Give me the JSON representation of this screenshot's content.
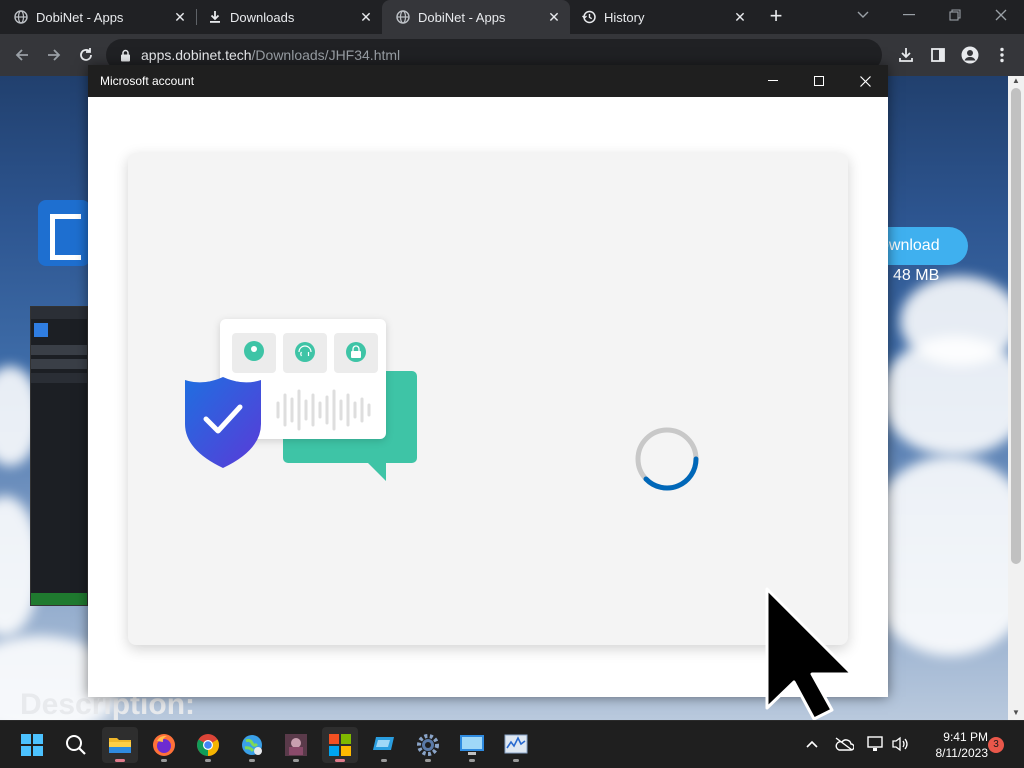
{
  "browser": {
    "tabs": [
      {
        "title": "DobiNet - Apps",
        "icon": "globe-icon",
        "active": false
      },
      {
        "title": "Downloads",
        "icon": "download-icon",
        "active": false
      },
      {
        "title": "DobiNet - Apps",
        "icon": "globe-icon",
        "active": true
      },
      {
        "title": "History",
        "icon": "history-icon",
        "active": false
      }
    ],
    "new_tab_label": "+",
    "url_host": "apps.dobinet.tech",
    "url_path": "/Downloads/JHF34.html"
  },
  "page": {
    "download_label": "ownload",
    "download_size": "48 MB",
    "description_heading": "Description:",
    "accent_color": "#3fb0ef"
  },
  "dialog": {
    "title": "Microsoft account",
    "state": "loading"
  },
  "taskbar": {
    "apps": [
      {
        "name": "start-icon"
      },
      {
        "name": "search-icon"
      },
      {
        "name": "file-explorer-icon",
        "active": true
      },
      {
        "name": "firefox-icon"
      },
      {
        "name": "chrome-icon"
      },
      {
        "name": "globe-app-icon"
      },
      {
        "name": "media-app-icon"
      },
      {
        "name": "microsoft-store-icon",
        "active": true
      },
      {
        "name": "disk-app-icon"
      },
      {
        "name": "settings-icon"
      },
      {
        "name": "remote-desktop-icon"
      },
      {
        "name": "resource-monitor-icon"
      }
    ],
    "time": "9:41 PM",
    "date": "8/11/2023",
    "notification_count": "3"
  }
}
